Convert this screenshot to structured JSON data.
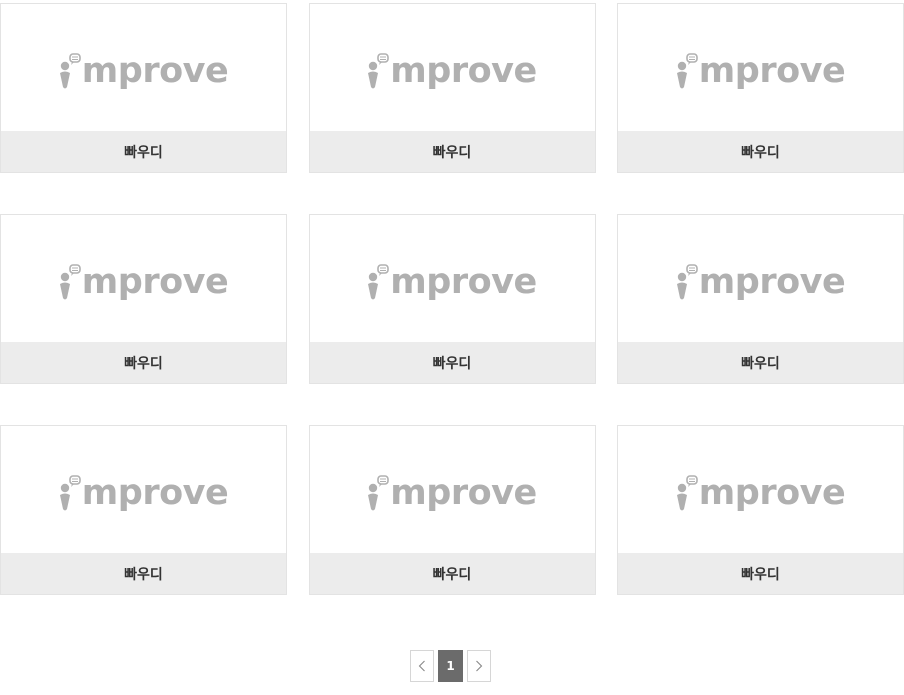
{
  "cards": [
    {
      "logo_text": "mprove",
      "caption": "빠우디"
    },
    {
      "logo_text": "mprove",
      "caption": "빠우디"
    },
    {
      "logo_text": "mprove",
      "caption": "빠우디"
    },
    {
      "logo_text": "mprove",
      "caption": "빠우디"
    },
    {
      "logo_text": "mprove",
      "caption": "빠우디"
    },
    {
      "logo_text": "mprove",
      "caption": "빠우디"
    },
    {
      "logo_text": "mprove",
      "caption": "빠우디"
    },
    {
      "logo_text": "mprove",
      "caption": "빠우디"
    },
    {
      "logo_text": "mprove",
      "caption": "빠우디"
    }
  ],
  "pagination": {
    "prev_icon": "chevron-left-icon",
    "next_icon": "chevron-right-icon",
    "current_page": "1"
  },
  "colors": {
    "logo_gray": "#b0b0b0",
    "caption_bg": "#ececec",
    "active_page_bg": "#6b6b6b"
  }
}
